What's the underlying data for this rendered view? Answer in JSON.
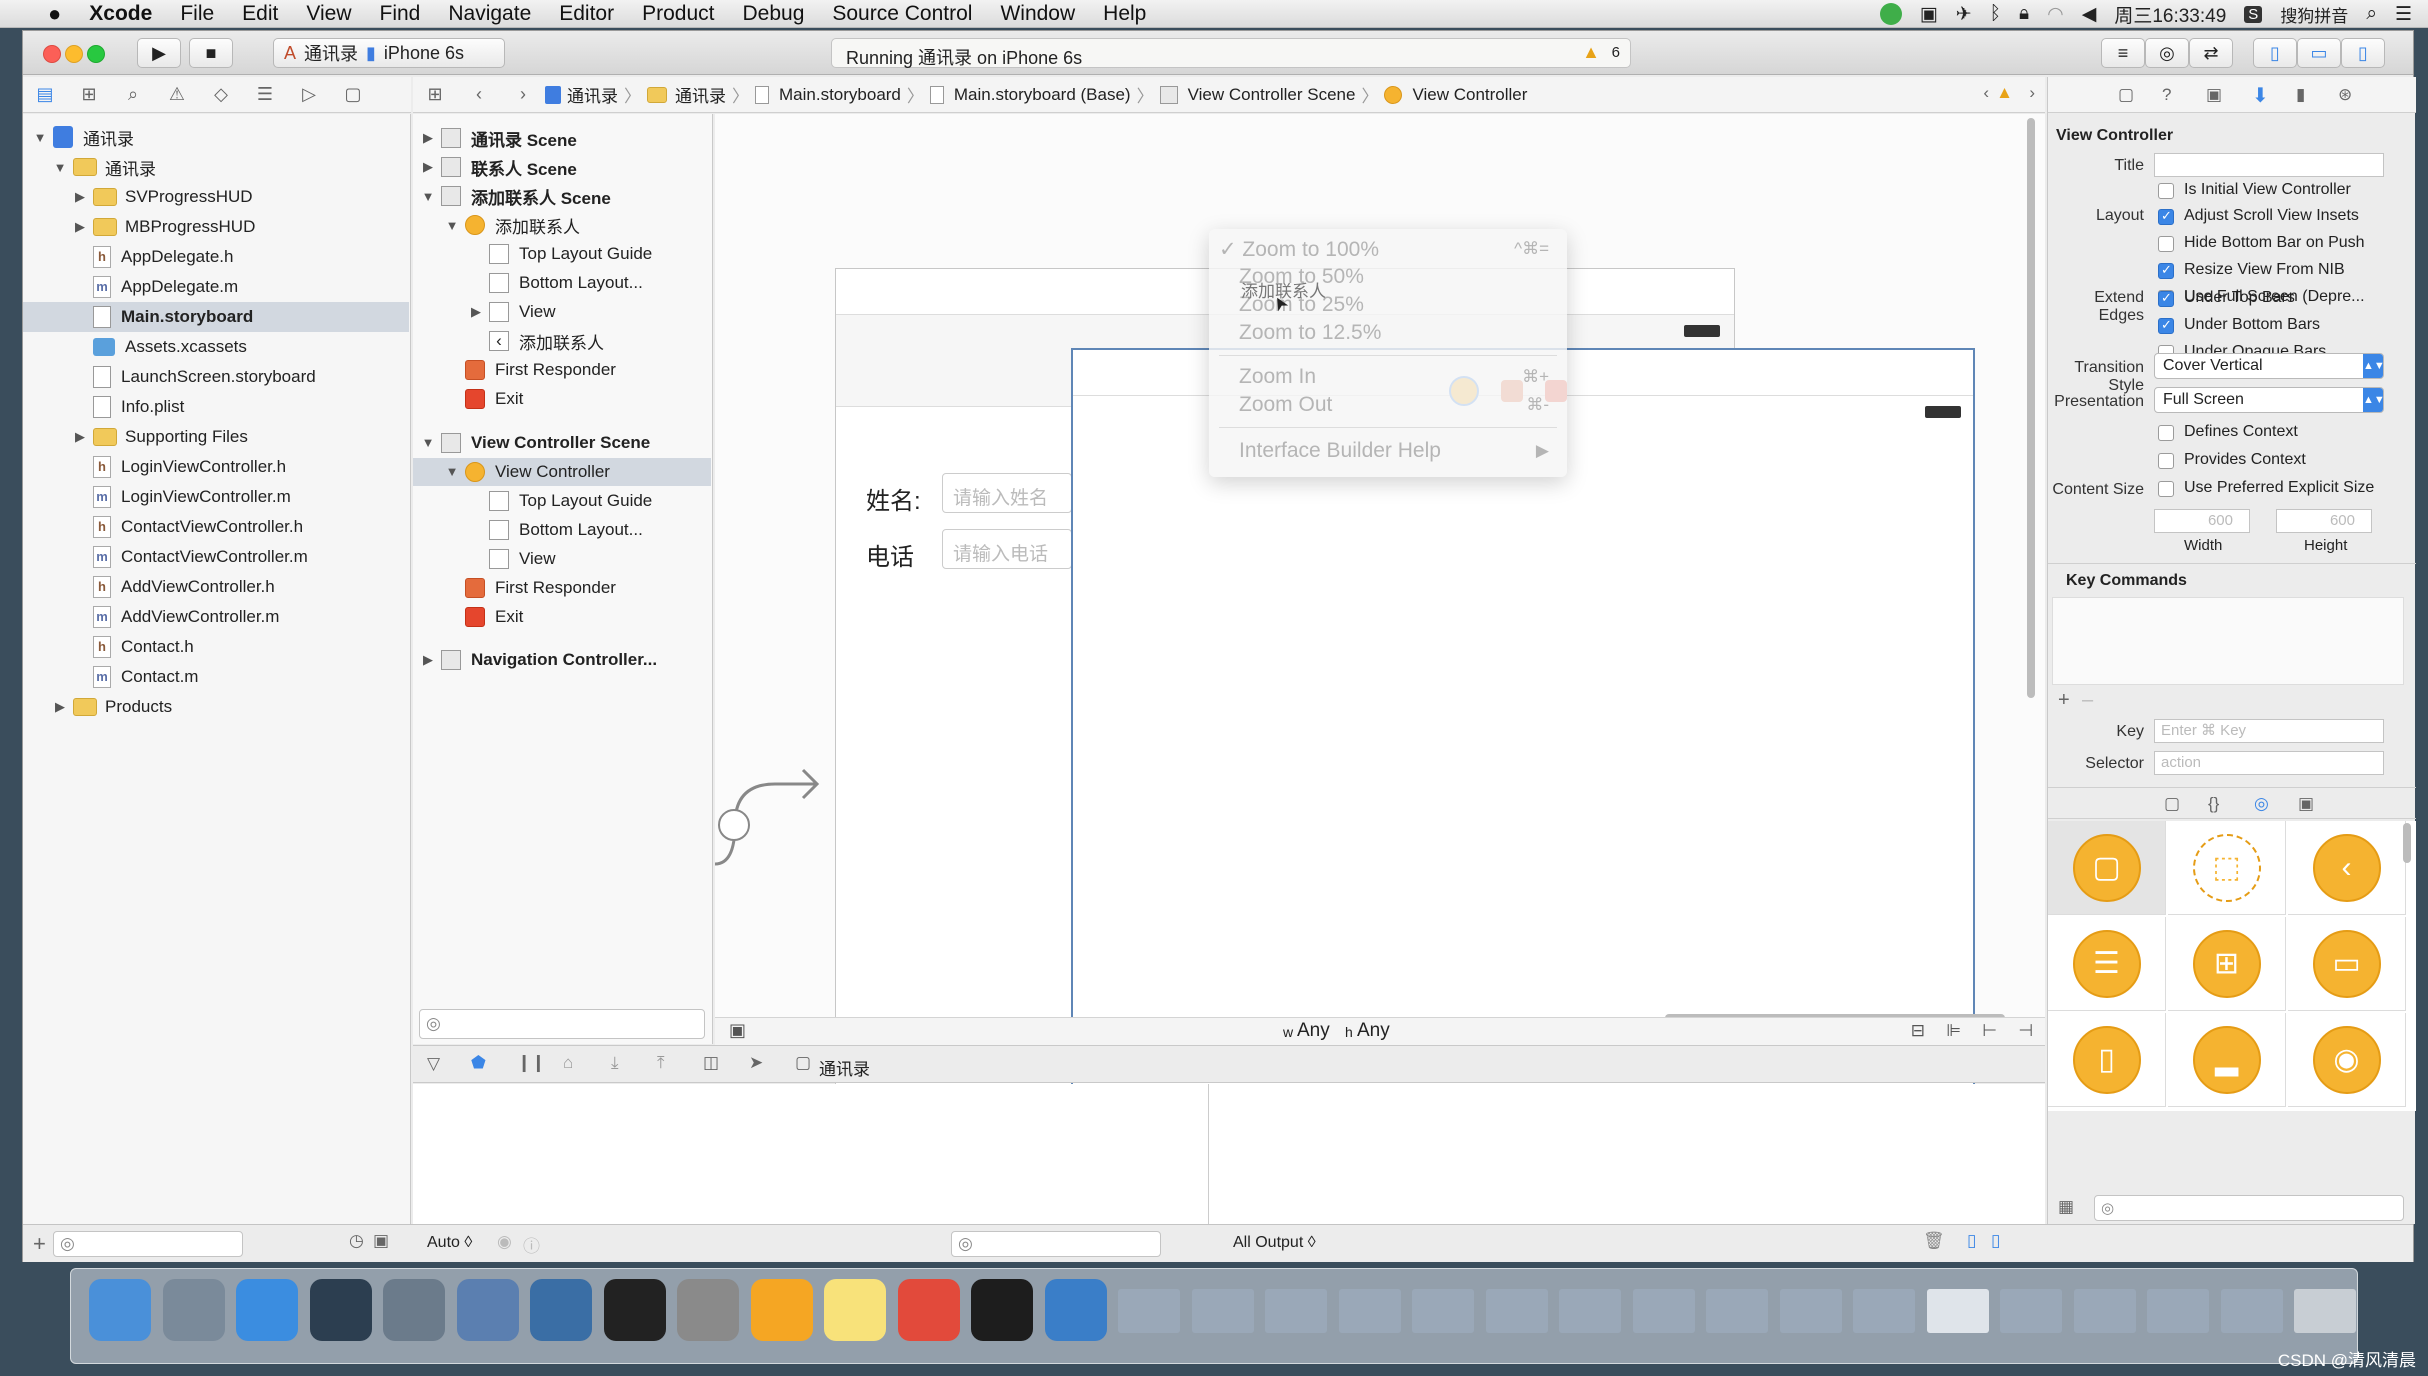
{
  "menubar": {
    "app_name": "Xcode",
    "items": [
      "File",
      "Edit",
      "View",
      "Find",
      "Navigate",
      "Editor",
      "Product",
      "Debug",
      "Source Control",
      "Window",
      "Help"
    ],
    "clock": "周三16:33:49",
    "input_method": "搜狗拼音"
  },
  "toolbar": {
    "scheme": "通讯录",
    "device": "iPhone 6s",
    "status": "Running 通讯录 on iPhone 6s",
    "warning_count": "6"
  },
  "jumpbar": {
    "crumbs": [
      "通讯录",
      "通讯录",
      "Main.storyboard",
      "Main.storyboard (Base)",
      "View Controller Scene",
      "View Controller"
    ]
  },
  "navigator": {
    "items": [
      {
        "label": "通讯录",
        "kind": "project",
        "indent": 0,
        "tri": "▼"
      },
      {
        "label": "通讯录",
        "kind": "folder",
        "indent": 1,
        "tri": "▼"
      },
      {
        "label": "SVProgressHUD",
        "kind": "folder",
        "indent": 2,
        "tri": "▶"
      },
      {
        "label": "MBProgressHUD",
        "kind": "folder",
        "indent": 2,
        "tri": "▶"
      },
      {
        "label": "AppDelegate.h",
        "kind": "h",
        "indent": 2,
        "tri": ""
      },
      {
        "label": "AppDelegate.m",
        "kind": "m",
        "indent": 2,
        "tri": ""
      },
      {
        "label": "Main.storyboard",
        "kind": "sb",
        "indent": 2,
        "tri": "",
        "selected": true
      },
      {
        "label": "Assets.xcassets",
        "kind": "asset",
        "indent": 2,
        "tri": ""
      },
      {
        "label": "LaunchScreen.storyboard",
        "kind": "sb",
        "indent": 2,
        "tri": ""
      },
      {
        "label": "Info.plist",
        "kind": "plist",
        "indent": 2,
        "tri": ""
      },
      {
        "label": "Supporting Files",
        "kind": "folder",
        "indent": 2,
        "tri": "▶"
      },
      {
        "label": "LoginViewController.h",
        "kind": "h",
        "indent": 2,
        "tri": ""
      },
      {
        "label": "LoginViewController.m",
        "kind": "m",
        "indent": 2,
        "tri": ""
      },
      {
        "label": "ContactViewController.h",
        "kind": "h",
        "indent": 2,
        "tri": ""
      },
      {
        "label": "ContactViewController.m",
        "kind": "m",
        "indent": 2,
        "tri": ""
      },
      {
        "label": "AddViewController.h",
        "kind": "h",
        "indent": 2,
        "tri": ""
      },
      {
        "label": "AddViewController.m",
        "kind": "m",
        "indent": 2,
        "tri": ""
      },
      {
        "label": "Contact.h",
        "kind": "h",
        "indent": 2,
        "tri": ""
      },
      {
        "label": "Contact.m",
        "kind": "m",
        "indent": 2,
        "tri": ""
      },
      {
        "label": "Products",
        "kind": "folder",
        "indent": 1,
        "tri": "▶"
      }
    ]
  },
  "outline": {
    "items": [
      {
        "label": "通讯录 Scene",
        "kind": "scene",
        "indent": 0,
        "tri": "▶",
        "bold": true
      },
      {
        "label": "联系人 Scene",
        "kind": "scene",
        "indent": 0,
        "tri": "▶",
        "bold": true
      },
      {
        "label": "添加联系人 Scene",
        "kind": "scene",
        "indent": 0,
        "tri": "▼",
        "bold": true
      },
      {
        "label": "添加联系人",
        "kind": "vc",
        "indent": 1,
        "tri": "▼"
      },
      {
        "label": "Top Layout Guide",
        "kind": "guide",
        "indent": 2,
        "tri": ""
      },
      {
        "label": "Bottom Layout...",
        "kind": "guide",
        "indent": 2,
        "tri": ""
      },
      {
        "label": "View",
        "kind": "guide",
        "indent": 2,
        "tri": "▶"
      },
      {
        "label": "添加联系人",
        "kind": "back",
        "indent": 2,
        "tri": ""
      },
      {
        "label": "First Responder",
        "kind": "fr",
        "indent": 1,
        "tri": ""
      },
      {
        "label": "Exit",
        "kind": "ex",
        "indent": 1,
        "tri": ""
      },
      {
        "label": "View Controller Scene",
        "kind": "scene",
        "indent": 0,
        "tri": "▼",
        "bold": true
      },
      {
        "label": "View Controller",
        "kind": "vc",
        "indent": 1,
        "tri": "▼",
        "selected": true
      },
      {
        "label": "Top Layout Guide",
        "kind": "guide",
        "indent": 2,
        "tri": ""
      },
      {
        "label": "Bottom Layout...",
        "kind": "guide",
        "indent": 2,
        "tri": ""
      },
      {
        "label": "View",
        "kind": "guide",
        "indent": 2,
        "tri": ""
      },
      {
        "label": "First Responder",
        "kind": "fr",
        "indent": 1,
        "tri": ""
      },
      {
        "label": "Exit",
        "kind": "ex",
        "indent": 1,
        "tri": ""
      },
      {
        "label": "Navigation Controller...",
        "kind": "scene",
        "indent": 0,
        "tri": "▶",
        "bold": true
      }
    ]
  },
  "canvas": {
    "name_label": "姓名:",
    "name_placeholder": "请输入姓名",
    "phone_label": "电话",
    "phone_placeholder": "请输入电话",
    "size_class_w": "Any",
    "size_class_h": "Any",
    "w_prefix": "w",
    "h_prefix": "h"
  },
  "zoom_menu": {
    "items": [
      {
        "label": "✓ Zoom to 100%",
        "shortcut": "^⌘="
      },
      {
        "label": "Zoom to 50%",
        "shortcut": ""
      },
      {
        "label": "Zoom to 25%",
        "shortcut": ""
      },
      {
        "label": "Zoom to 12.5%",
        "shortcut": ""
      },
      {
        "label": "Zoom In",
        "shortcut": "⌘+"
      },
      {
        "label": "Zoom Out",
        "shortcut": "⌘-"
      },
      {
        "label": "Interface Builder Help",
        "shortcut": "▶"
      }
    ],
    "overlay_text": "添加联系人"
  },
  "debug": {
    "target": "通讯录",
    "auto_label": "Auto ◊",
    "output_label": "All Output ◊"
  },
  "inspector": {
    "section_title": "View Controller",
    "title_label": "Title",
    "title_value": "",
    "is_initial": "Is Initial View Controller",
    "layout_label": "Layout",
    "layout_opts": [
      {
        "label": "Adjust Scroll View Insets",
        "on": true
      },
      {
        "label": "Hide Bottom Bar on Push",
        "on": false
      },
      {
        "label": "Resize View From NIB",
        "on": true
      },
      {
        "label": "Use Full Screen (Depre...",
        "on": false
      }
    ],
    "extend_label": "Extend Edges",
    "extend_opts": [
      {
        "label": "Under Top Bars",
        "on": true
      },
      {
        "label": "Under Bottom Bars",
        "on": true
      },
      {
        "label": "Under Opaque Bars",
        "on": false
      }
    ],
    "transition_label": "Transition Style",
    "transition_value": "Cover Vertical",
    "presentation_label": "Presentation",
    "presentation_value": "Full Screen",
    "defines_context": "Defines Context",
    "provides_context": "Provides Context",
    "content_size_label": "Content Size",
    "preferred_size": "Use Preferred Explicit Size",
    "width_value": "600",
    "height_value": "600",
    "width_label": "Width",
    "height_label": "Height",
    "key_commands": "Key Commands",
    "key_label": "Key",
    "key_placeholder": "Enter ⌘ Key",
    "selector_label": "Selector",
    "selector_placeholder": "action"
  },
  "watermark": "CSDN @清风清晨"
}
